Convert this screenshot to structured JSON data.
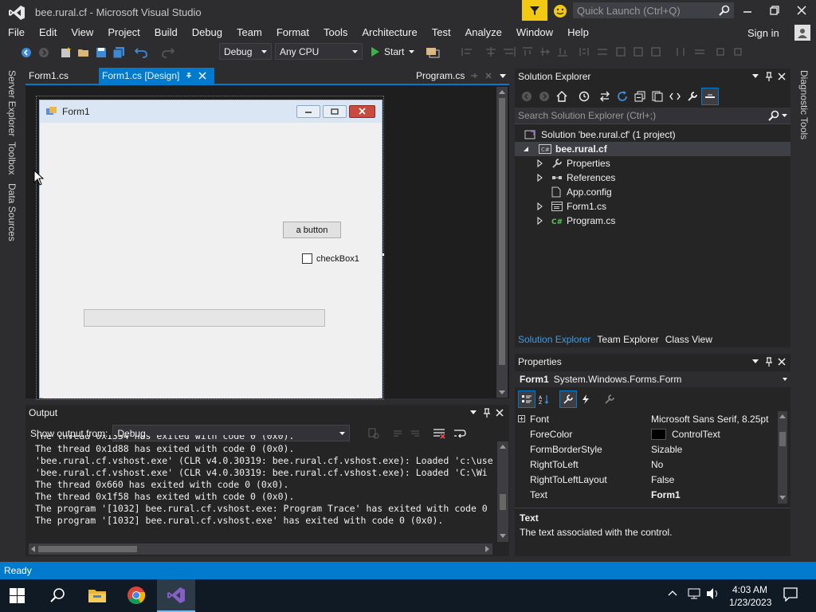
{
  "window": {
    "title": "bee.rural.cf - Microsoft Visual Studio",
    "quick_launch_placeholder": "Quick Launch (Ctrl+Q)",
    "sign_in": "Sign in"
  },
  "menu": [
    "File",
    "Edit",
    "View",
    "Project",
    "Build",
    "Debug",
    "Team",
    "Format",
    "Tools",
    "Architecture",
    "Test",
    "Analyze",
    "Window",
    "Help"
  ],
  "toolbar": {
    "config": "Debug",
    "platform": "Any CPU",
    "start": "Start"
  },
  "left_rail": [
    "Server Explorer",
    "Toolbox",
    "Data Sources"
  ],
  "doc_tabs": {
    "tab1": "Form1.cs",
    "tab2": "Form1.cs [Design]",
    "tab3": "Program.cs"
  },
  "form": {
    "title": "Form1",
    "button_label": "a button",
    "checkbox_label": "checkBox1"
  },
  "solution_explorer": {
    "title": "Solution Explorer",
    "search_placeholder": "Search Solution Explorer (Ctrl+;)",
    "solution": "Solution 'bee.rural.cf' (1 project)",
    "project": "bee.rural.cf",
    "items": [
      "Properties",
      "References",
      "App.config",
      "Form1.cs",
      "Program.cs"
    ],
    "bottom_tabs": [
      "Solution Explorer",
      "Team Explorer",
      "Class View"
    ]
  },
  "properties": {
    "title": "Properties",
    "object": "Form1",
    "object_type": "System.Windows.Forms.Form",
    "rows": [
      {
        "name": "Font",
        "value": "Microsoft Sans Serif, 8.25pt"
      },
      {
        "name": "ForeColor",
        "value": "ControlText"
      },
      {
        "name": "FormBorderStyle",
        "value": "Sizable"
      },
      {
        "name": "RightToLeft",
        "value": "No"
      },
      {
        "name": "RightToLeftLayout",
        "value": "False"
      },
      {
        "name": "Text",
        "value": "Form1"
      }
    ],
    "desc_title": "Text",
    "desc_text": "The text associated with the control."
  },
  "output": {
    "title": "Output",
    "show_from_label": "Show output from:",
    "source": "Debug",
    "lines": [
      "The thread 0x1334 has exited with code 0 (0x0).",
      "The thread 0x1d88 has exited with code 0 (0x0).",
      "'bee.rural.cf.vshost.exe' (CLR v4.0.30319: bee.rural.cf.vshost.exe): Loaded 'c:\\use",
      "'bee.rural.cf.vshost.exe' (CLR v4.0.30319: bee.rural.cf.vshost.exe): Loaded 'C:\\Wi",
      "The thread 0x660 has exited with code 0 (0x0).",
      "The thread 0x1f58 has exited with code 0 (0x0).",
      "The program '[1032] bee.rural.cf.vshost.exe: Program Trace' has exited with code 0",
      "The program '[1032] bee.rural.cf.vshost.exe' has exited with code 0 (0x0)."
    ]
  },
  "diagnostic_tools": "Diagnostic Tools",
  "status": "Ready",
  "taskbar": {
    "time": "4:03 AM",
    "date": "1/23/2023"
  },
  "colors": {
    "accent": "#007acc",
    "vs_purple": "#865fc5",
    "chrome_bg": "#2d2d30",
    "panel_bg": "#252526"
  }
}
